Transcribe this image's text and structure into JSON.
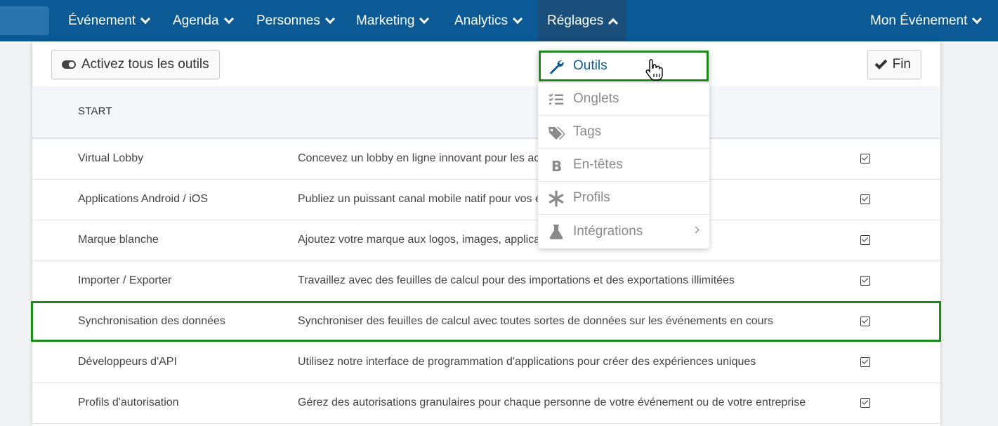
{
  "nav": {
    "items": [
      {
        "label": "Événement"
      },
      {
        "label": "Agenda"
      },
      {
        "label": "Personnes"
      },
      {
        "label": "Marketing"
      },
      {
        "label": "Analytics"
      },
      {
        "label": "Réglages"
      }
    ],
    "right": {
      "label": "Mon Événement"
    }
  },
  "toolbar": {
    "toggle_label": "Activez tous les outils",
    "fin_label": "Fin"
  },
  "section": {
    "title": "START"
  },
  "rows": [
    {
      "name": "Virtual Lobby",
      "desc": "Concevez un lobby en ligne innovant pour les ac",
      "checked": true
    },
    {
      "name": "Applications Android / iOS",
      "desc": "Publiez un puissant canal mobile natif pour vos é",
      "checked": true
    },
    {
      "name": "Marque blanche",
      "desc": "Ajoutez votre marque aux logos, images, applicat",
      "checked": true
    },
    {
      "name": "Importer / Exporter",
      "desc": "Travaillez avec des feuilles de calcul pour des importations et des exportations illimitées",
      "checked": true
    },
    {
      "name": "Synchronisation des données",
      "desc": "Synchroniser des feuilles de calcul avec toutes sortes de données sur les événements en cours",
      "checked": true
    },
    {
      "name": "Développeurs d'API",
      "desc": "Utilisez notre interface de programmation d'applications pour créer des expériences uniques",
      "checked": true
    },
    {
      "name": "Profils d'autorisation",
      "desc": "Gérez des autorisations granulaires pour chaque personne de votre événement ou de votre entreprise",
      "checked": true
    }
  ],
  "dropdown": {
    "items": [
      {
        "label": "Outils",
        "icon": "wrench-icon"
      },
      {
        "label": "Onglets",
        "icon": "checklist-icon"
      },
      {
        "label": "Tags",
        "icon": "tags-icon"
      },
      {
        "label": "En-têtes",
        "icon": "bold-icon"
      },
      {
        "label": "Profils",
        "icon": "asterisk-icon"
      },
      {
        "label": "Intégrations",
        "icon": "flask-icon"
      }
    ]
  },
  "colors": {
    "navbar": "#0b5a96",
    "active": "#0b5a96",
    "highlight": "#1a8a1a"
  }
}
